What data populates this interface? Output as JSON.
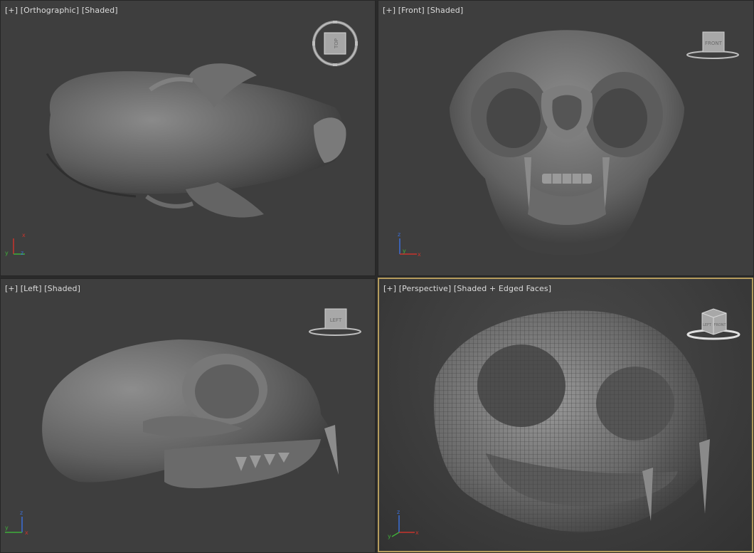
{
  "viewports": [
    {
      "id": "top",
      "plus": "[+]",
      "view": "[Orthographic]",
      "shading": "[Shaded]",
      "cube": "",
      "axes": [
        "y",
        "x",
        "z"
      ]
    },
    {
      "id": "front",
      "plus": "[+]",
      "view": "[Front]",
      "shading": "[Shaded]",
      "cube": "FRONT",
      "axes": [
        "z",
        "y",
        "x"
      ]
    },
    {
      "id": "left",
      "plus": "[+]",
      "view": "[Left]",
      "shading": "[Shaded]",
      "cube": "LEFT",
      "axes": [
        "z",
        "y",
        "x"
      ]
    },
    {
      "id": "persp",
      "plus": "[+]",
      "view": "[Perspective]",
      "shading": "[Shaded + Edged Faces]",
      "cube": "FRONT",
      "cube_side": "LEFT",
      "axes": [
        "z",
        "x",
        "y"
      ]
    }
  ],
  "colors": {
    "active_border": "#b59c5d",
    "viewport_bg": "#3e3e3e",
    "axis_x": "#c8342c",
    "axis_y": "#3fae3a",
    "axis_z": "#3a6fd8"
  },
  "active_viewport": "persp",
  "model": "cat-skull"
}
